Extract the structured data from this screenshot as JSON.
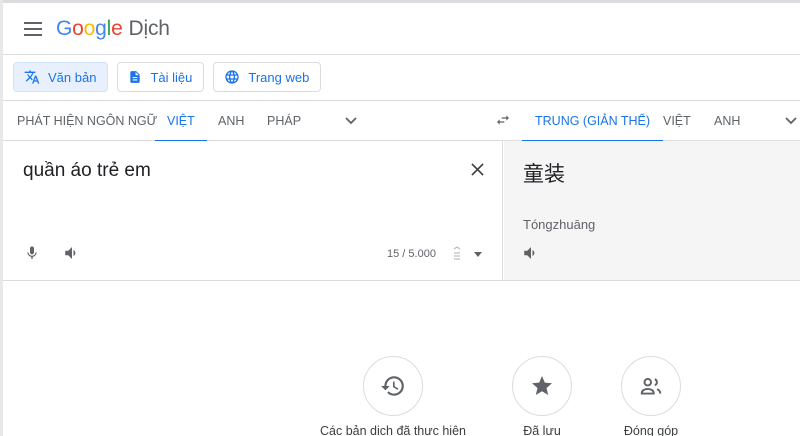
{
  "app": {
    "logo_letters": [
      "G",
      "o",
      "o",
      "g",
      "l",
      "e"
    ],
    "product_name": "Dịch"
  },
  "modes": [
    {
      "label": "Văn bản",
      "icon": "translate-icon",
      "active": true
    },
    {
      "label": "Tài liệu",
      "icon": "document-icon",
      "active": false
    },
    {
      "label": "Trang web",
      "icon": "globe-icon",
      "active": false
    }
  ],
  "source_languages": [
    {
      "label": "PHÁT HIỆN NGÔN NGỮ",
      "selected": false
    },
    {
      "label": "VIỆT",
      "selected": true
    },
    {
      "label": "ANH",
      "selected": false
    },
    {
      "label": "PHÁP",
      "selected": false
    }
  ],
  "target_languages": [
    {
      "label": "TRUNG (GIẢN THỂ)",
      "selected": true
    },
    {
      "label": "VIỆT",
      "selected": false
    },
    {
      "label": "ANH",
      "selected": false
    }
  ],
  "source": {
    "text": "quần áo trẻ em",
    "char_count": "15 / 5.000"
  },
  "target": {
    "text": "童装",
    "transliteration": "Tóngzhuāng"
  },
  "actions": [
    {
      "label": "Các bản dịch đã thực hiện",
      "icon": "history-icon"
    },
    {
      "label": "Đã lưu",
      "icon": "star-icon"
    },
    {
      "label": "Đóng góp",
      "icon": "people-icon"
    }
  ],
  "colors": {
    "accent": "#1a73e8",
    "text_primary": "#202124",
    "text_secondary": "#5f6368",
    "border": "#dadce0",
    "target_bg": "#f5f5f5"
  }
}
